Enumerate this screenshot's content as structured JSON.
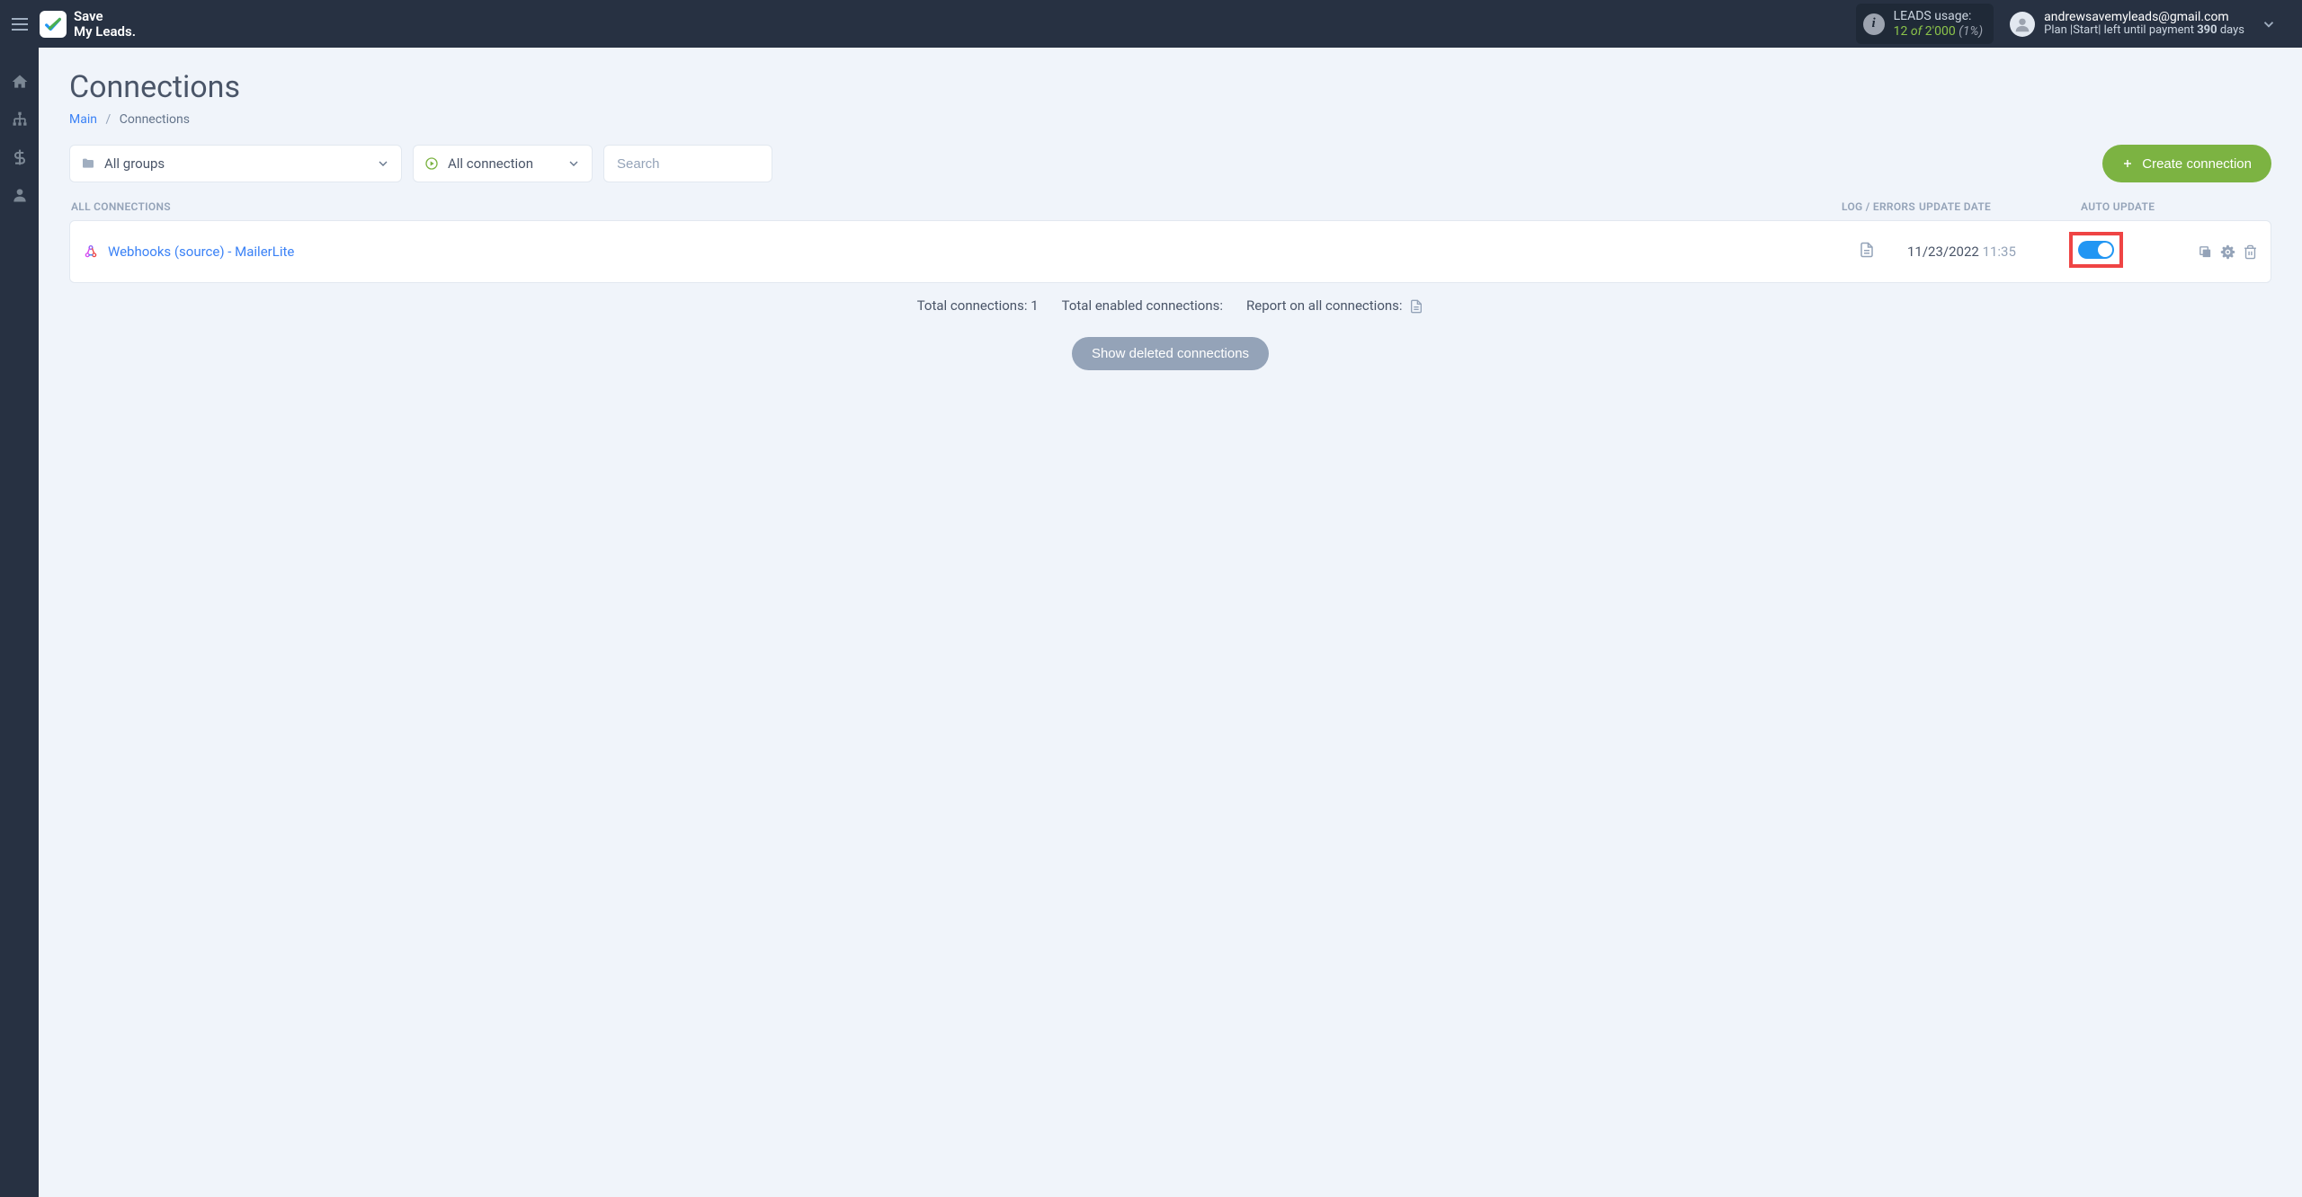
{
  "brand": {
    "line1": "Save",
    "line2": "My Leads."
  },
  "leads": {
    "label": "LEADS usage:",
    "used": "12",
    "of": "of",
    "total": "2'000",
    "pct": "(1%)"
  },
  "user": {
    "email": "andrewsavemyleads@gmail.com",
    "plan_prefix": "Plan |",
    "plan_name": "Start",
    "plan_mid": "| left until payment ",
    "days": "390",
    "days_suffix": " days"
  },
  "page": {
    "title": "Connections"
  },
  "breadcrumb": {
    "main": "Main",
    "sep": "/",
    "current": "Connections"
  },
  "filters": {
    "groups": "All groups",
    "status": "All connection",
    "search_placeholder": "Search",
    "create": "Create connection"
  },
  "headers": {
    "all": "ALL CONNECTIONS",
    "log": "LOG / ERRORS",
    "update": "UPDATE DATE",
    "auto": "AUTO UPDATE"
  },
  "row": {
    "name": "Webhooks (source) - MailerLite",
    "date": "11/23/2022",
    "time": "11:35"
  },
  "stats": {
    "total_label": "Total connections: ",
    "total_value": "1",
    "enabled_label": "Total enabled connections:",
    "report_label": "Report on all connections:"
  },
  "show_deleted": "Show deleted connections"
}
